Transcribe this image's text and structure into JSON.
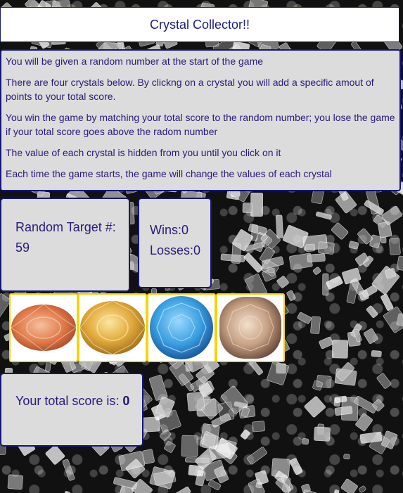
{
  "header": {
    "title": "Crystal Collector!!"
  },
  "instructions": [
    "You will be given a random number at the start of the game",
    "There are four crystals below. By clickng on a crystal you will add a specific amout of points to your total score.",
    "You win the game by matching your total score to the random number; you lose the game if your total score goes above the radom number",
    "The value of each crystal is hidden from you until you click on it",
    "Each time the game starts, the game will change the values of each crystal"
  ],
  "target": {
    "label": "Random Target #:",
    "value": "59"
  },
  "stats": {
    "wins_label": "Wins:",
    "wins": "0",
    "losses_label": "Losses:",
    "losses": "0"
  },
  "crystals": [
    {
      "icon": "orange-oval-gem-icon",
      "color": "#e07a4a"
    },
    {
      "icon": "yellow-oval-gem-icon",
      "color": "#e0a83a"
    },
    {
      "icon": "blue-round-gem-icon",
      "color": "#3a9fe0"
    },
    {
      "icon": "champagne-cushion-gem-icon",
      "color": "#c7a285"
    }
  ],
  "score": {
    "label": "Your total score is: ",
    "value": "0"
  }
}
